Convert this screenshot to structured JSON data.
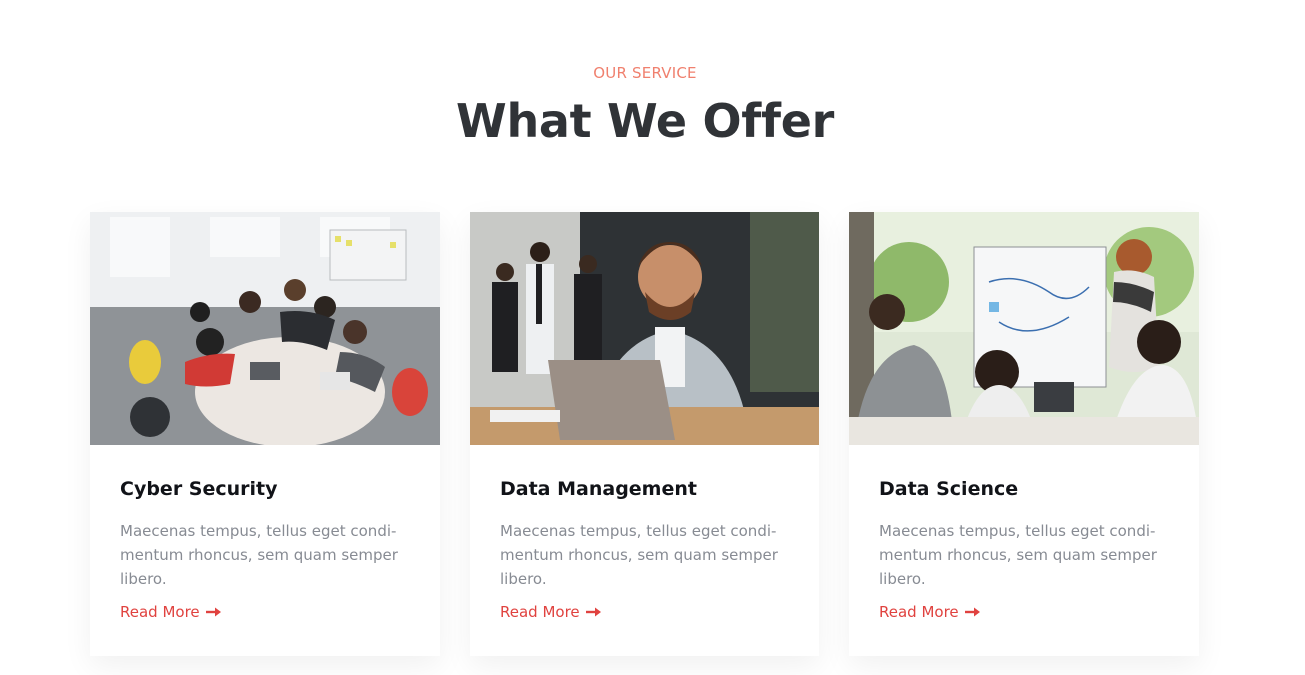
{
  "section": {
    "eyebrow": "OUR SERVICE",
    "heading": "What We Offer"
  },
  "cards": [
    {
      "title": "Cyber Security",
      "description": "Maecenas tempus, tellus eget condi-mentum rhoncus, sem quam semper libero.",
      "link": "Read More"
    },
    {
      "title": "Data Management",
      "description": "Maecenas tempus, tellus eget condi-mentum rhoncus, sem quam semper libero.",
      "link": "Read More"
    },
    {
      "title": "Data Science",
      "description": "Maecenas tempus, tellus eget condi-mentum rhoncus, sem quam semper libero.",
      "link": "Read More"
    }
  ],
  "colors": {
    "accent": "#e0423f",
    "eyebrow": "#f0806e",
    "heading": "#303337",
    "body_text": "#878b93"
  },
  "icons": {
    "link_arrow": "arrow-right-icon"
  }
}
